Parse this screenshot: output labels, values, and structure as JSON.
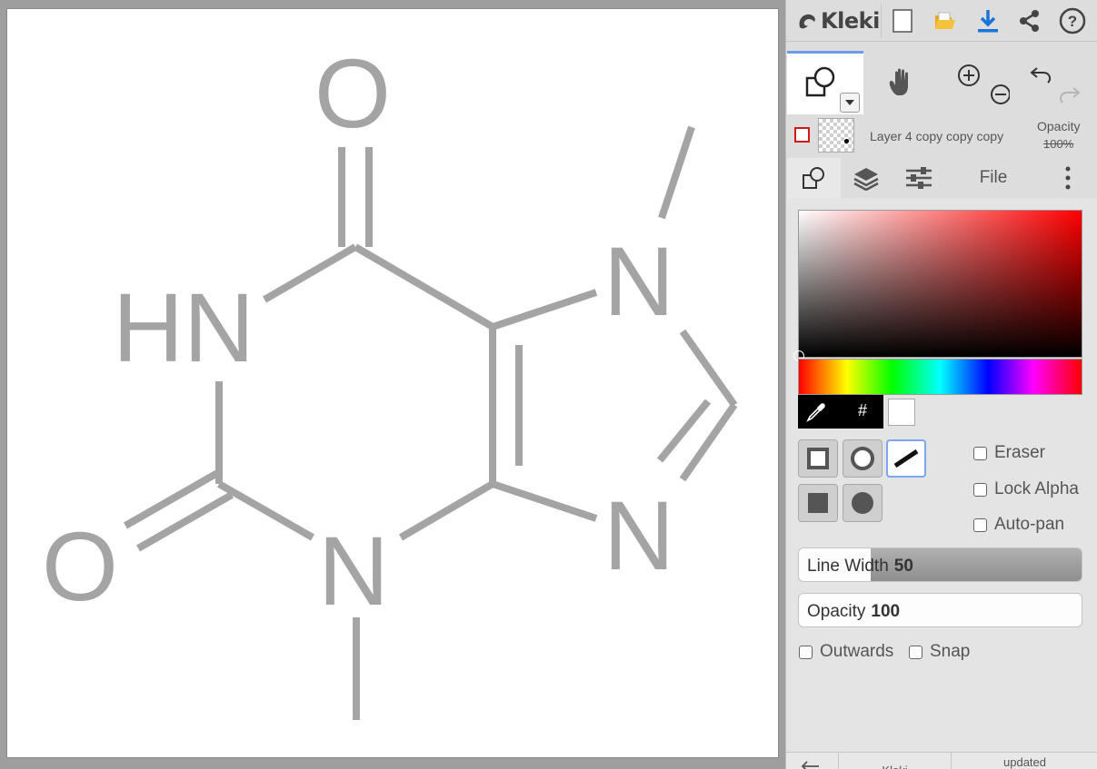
{
  "app": {
    "name": "Kleki"
  },
  "canvas": {
    "molecule": {
      "color": "#a4a4a4",
      "labels": {
        "o_top": "O",
        "o_left": "O",
        "hn": "HN",
        "n_bottom": "N",
        "n_right_top": "N",
        "n_right_bottom": "N"
      }
    }
  },
  "topbar": {
    "icons": [
      "kleki-logo-icon",
      "new-image-icon",
      "open-folder-icon",
      "download-icon",
      "share-icon",
      "help-icon"
    ]
  },
  "tools": {
    "active": "shape",
    "items": [
      "shape-tool-icon",
      "hand-tool-icon",
      "zoom-in-icon",
      "zoom-out-icon",
      "undo-icon",
      "redo-icon"
    ]
  },
  "layer": {
    "name": "Layer 4 copy copy copy",
    "opacity_label": "Opacity",
    "opacity_value": "100%"
  },
  "tabs": {
    "file_label": "File",
    "active": "shape"
  },
  "color": {
    "primary": "#000000",
    "secondary": "#ffffff",
    "hue": "#ff0000",
    "hash": "#"
  },
  "shape_options": {
    "selected": "line",
    "eraser_label": "Eraser",
    "lock_alpha_label": "Lock Alpha",
    "auto_pan_label": "Auto-pan",
    "line_width_label": "Line Width",
    "line_width_value": "50",
    "line_width_fraction": 0.5,
    "opacity_label": "Opacity",
    "opacity_value": "100",
    "outwards_label": "Outwards",
    "snap_label": "Snap"
  },
  "bottombar": {
    "kleki_label": "Kleki",
    "updated_label": "updated"
  }
}
